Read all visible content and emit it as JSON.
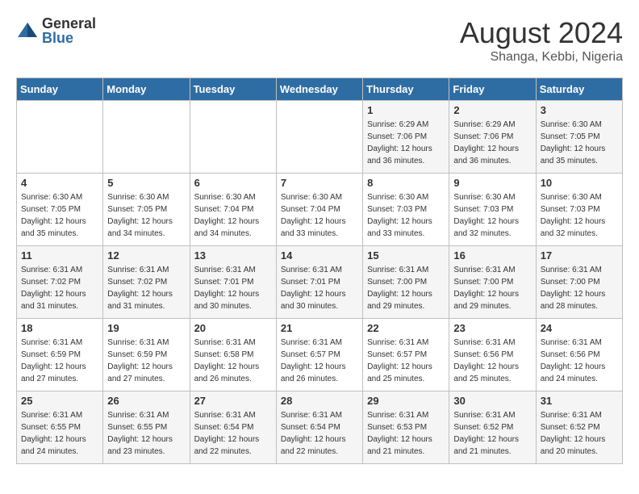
{
  "header": {
    "logo": {
      "general": "General",
      "blue": "Blue"
    },
    "title": "August 2024",
    "location": "Shanga, Kebbi, Nigeria"
  },
  "days_of_week": [
    "Sunday",
    "Monday",
    "Tuesday",
    "Wednesday",
    "Thursday",
    "Friday",
    "Saturday"
  ],
  "weeks": [
    [
      {
        "day": "",
        "sunrise": "",
        "sunset": "",
        "daylight": ""
      },
      {
        "day": "",
        "sunrise": "",
        "sunset": "",
        "daylight": ""
      },
      {
        "day": "",
        "sunrise": "",
        "sunset": "",
        "daylight": ""
      },
      {
        "day": "",
        "sunrise": "",
        "sunset": "",
        "daylight": ""
      },
      {
        "day": "1",
        "sunrise": "Sunrise: 6:29 AM",
        "sunset": "Sunset: 7:06 PM",
        "daylight": "Daylight: 12 hours and 36 minutes."
      },
      {
        "day": "2",
        "sunrise": "Sunrise: 6:29 AM",
        "sunset": "Sunset: 7:06 PM",
        "daylight": "Daylight: 12 hours and 36 minutes."
      },
      {
        "day": "3",
        "sunrise": "Sunrise: 6:30 AM",
        "sunset": "Sunset: 7:05 PM",
        "daylight": "Daylight: 12 hours and 35 minutes."
      }
    ],
    [
      {
        "day": "4",
        "sunrise": "Sunrise: 6:30 AM",
        "sunset": "Sunset: 7:05 PM",
        "daylight": "Daylight: 12 hours and 35 minutes."
      },
      {
        "day": "5",
        "sunrise": "Sunrise: 6:30 AM",
        "sunset": "Sunset: 7:05 PM",
        "daylight": "Daylight: 12 hours and 34 minutes."
      },
      {
        "day": "6",
        "sunrise": "Sunrise: 6:30 AM",
        "sunset": "Sunset: 7:04 PM",
        "daylight": "Daylight: 12 hours and 34 minutes."
      },
      {
        "day": "7",
        "sunrise": "Sunrise: 6:30 AM",
        "sunset": "Sunset: 7:04 PM",
        "daylight": "Daylight: 12 hours and 33 minutes."
      },
      {
        "day": "8",
        "sunrise": "Sunrise: 6:30 AM",
        "sunset": "Sunset: 7:03 PM",
        "daylight": "Daylight: 12 hours and 33 minutes."
      },
      {
        "day": "9",
        "sunrise": "Sunrise: 6:30 AM",
        "sunset": "Sunset: 7:03 PM",
        "daylight": "Daylight: 12 hours and 32 minutes."
      },
      {
        "day": "10",
        "sunrise": "Sunrise: 6:30 AM",
        "sunset": "Sunset: 7:03 PM",
        "daylight": "Daylight: 12 hours and 32 minutes."
      }
    ],
    [
      {
        "day": "11",
        "sunrise": "Sunrise: 6:31 AM",
        "sunset": "Sunset: 7:02 PM",
        "daylight": "Daylight: 12 hours and 31 minutes."
      },
      {
        "day": "12",
        "sunrise": "Sunrise: 6:31 AM",
        "sunset": "Sunset: 7:02 PM",
        "daylight": "Daylight: 12 hours and 31 minutes."
      },
      {
        "day": "13",
        "sunrise": "Sunrise: 6:31 AM",
        "sunset": "Sunset: 7:01 PM",
        "daylight": "Daylight: 12 hours and 30 minutes."
      },
      {
        "day": "14",
        "sunrise": "Sunrise: 6:31 AM",
        "sunset": "Sunset: 7:01 PM",
        "daylight": "Daylight: 12 hours and 30 minutes."
      },
      {
        "day": "15",
        "sunrise": "Sunrise: 6:31 AM",
        "sunset": "Sunset: 7:00 PM",
        "daylight": "Daylight: 12 hours and 29 minutes."
      },
      {
        "day": "16",
        "sunrise": "Sunrise: 6:31 AM",
        "sunset": "Sunset: 7:00 PM",
        "daylight": "Daylight: 12 hours and 29 minutes."
      },
      {
        "day": "17",
        "sunrise": "Sunrise: 6:31 AM",
        "sunset": "Sunset: 7:00 PM",
        "daylight": "Daylight: 12 hours and 28 minutes."
      }
    ],
    [
      {
        "day": "18",
        "sunrise": "Sunrise: 6:31 AM",
        "sunset": "Sunset: 6:59 PM",
        "daylight": "Daylight: 12 hours and 27 minutes."
      },
      {
        "day": "19",
        "sunrise": "Sunrise: 6:31 AM",
        "sunset": "Sunset: 6:59 PM",
        "daylight": "Daylight: 12 hours and 27 minutes."
      },
      {
        "day": "20",
        "sunrise": "Sunrise: 6:31 AM",
        "sunset": "Sunset: 6:58 PM",
        "daylight": "Daylight: 12 hours and 26 minutes."
      },
      {
        "day": "21",
        "sunrise": "Sunrise: 6:31 AM",
        "sunset": "Sunset: 6:57 PM",
        "daylight": "Daylight: 12 hours and 26 minutes."
      },
      {
        "day": "22",
        "sunrise": "Sunrise: 6:31 AM",
        "sunset": "Sunset: 6:57 PM",
        "daylight": "Daylight: 12 hours and 25 minutes."
      },
      {
        "day": "23",
        "sunrise": "Sunrise: 6:31 AM",
        "sunset": "Sunset: 6:56 PM",
        "daylight": "Daylight: 12 hours and 25 minutes."
      },
      {
        "day": "24",
        "sunrise": "Sunrise: 6:31 AM",
        "sunset": "Sunset: 6:56 PM",
        "daylight": "Daylight: 12 hours and 24 minutes."
      }
    ],
    [
      {
        "day": "25",
        "sunrise": "Sunrise: 6:31 AM",
        "sunset": "Sunset: 6:55 PM",
        "daylight": "Daylight: 12 hours and 24 minutes."
      },
      {
        "day": "26",
        "sunrise": "Sunrise: 6:31 AM",
        "sunset": "Sunset: 6:55 PM",
        "daylight": "Daylight: 12 hours and 23 minutes."
      },
      {
        "day": "27",
        "sunrise": "Sunrise: 6:31 AM",
        "sunset": "Sunset: 6:54 PM",
        "daylight": "Daylight: 12 hours and 22 minutes."
      },
      {
        "day": "28",
        "sunrise": "Sunrise: 6:31 AM",
        "sunset": "Sunset: 6:54 PM",
        "daylight": "Daylight: 12 hours and 22 minutes."
      },
      {
        "day": "29",
        "sunrise": "Sunrise: 6:31 AM",
        "sunset": "Sunset: 6:53 PM",
        "daylight": "Daylight: 12 hours and 21 minutes."
      },
      {
        "day": "30",
        "sunrise": "Sunrise: 6:31 AM",
        "sunset": "Sunset: 6:52 PM",
        "daylight": "Daylight: 12 hours and 21 minutes."
      },
      {
        "day": "31",
        "sunrise": "Sunrise: 6:31 AM",
        "sunset": "Sunset: 6:52 PM",
        "daylight": "Daylight: 12 hours and 20 minutes."
      }
    ]
  ]
}
